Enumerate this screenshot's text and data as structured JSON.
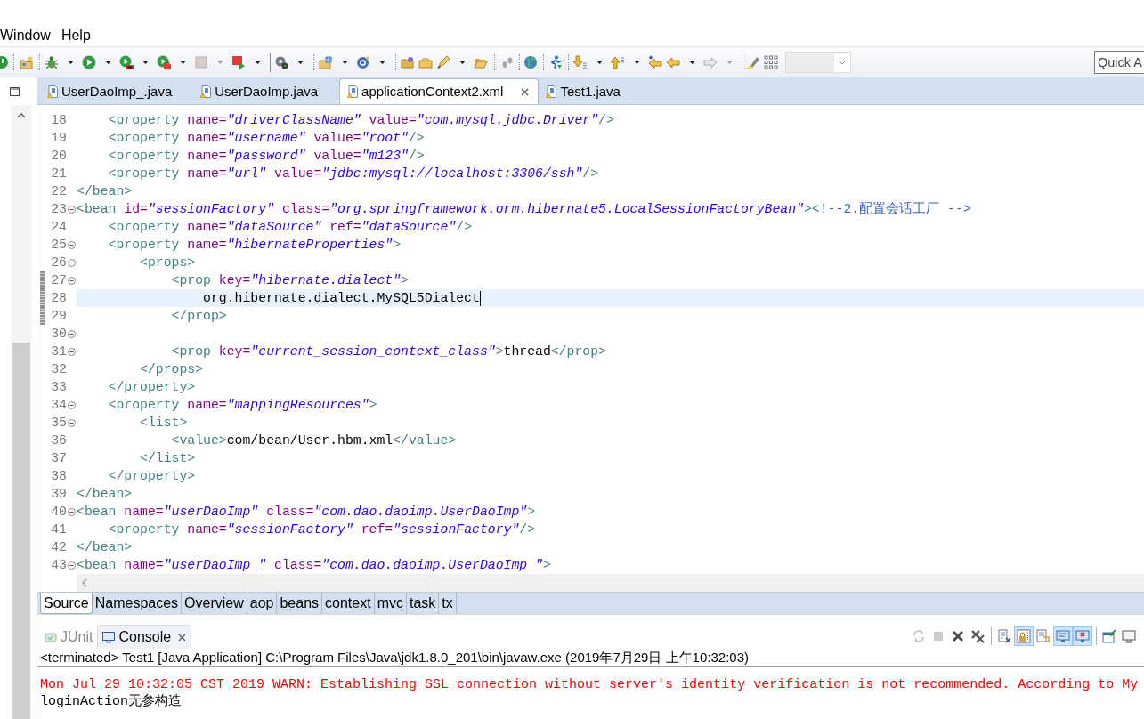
{
  "menu": [
    {
      "label": "Window"
    },
    {
      "label": "Help"
    }
  ],
  "quick_access": {
    "placeholder": "Quick A"
  },
  "editor_tabs": [
    {
      "label": "UserDaoImp_.java",
      "selected": false
    },
    {
      "label": "UserDaoImp.java",
      "selected": false
    },
    {
      "label": "applicationContext2.xml",
      "selected": true
    },
    {
      "label": "Test1.java",
      "selected": false
    }
  ],
  "code_lines": [
    {
      "number": "18",
      "fold": false,
      "marked": false,
      "current": false,
      "tokens": [
        {
          "kind": "tag",
          "text": "    <property"
        },
        {
          "kind": "attr",
          "text": " name="
        },
        {
          "kind": "value",
          "text": "\"driverClassName\""
        },
        {
          "kind": "attr",
          "text": " value="
        },
        {
          "kind": "value",
          "text": "\"com.mysql.jdbc.Driver\""
        },
        {
          "kind": "tag",
          "text": "/>"
        }
      ]
    },
    {
      "number": "19",
      "fold": false,
      "marked": false,
      "current": false,
      "tokens": [
        {
          "kind": "tag",
          "text": "    <property"
        },
        {
          "kind": "attr",
          "text": " name="
        },
        {
          "kind": "value",
          "text": "\"username\""
        },
        {
          "kind": "attr",
          "text": " value="
        },
        {
          "kind": "value",
          "text": "\"root\""
        },
        {
          "kind": "tag",
          "text": "/>"
        }
      ]
    },
    {
      "number": "20",
      "fold": false,
      "marked": false,
      "current": false,
      "tokens": [
        {
          "kind": "tag",
          "text": "    <property"
        },
        {
          "kind": "attr",
          "text": " name="
        },
        {
          "kind": "value",
          "text": "\"password\""
        },
        {
          "kind": "attr",
          "text": " value="
        },
        {
          "kind": "value",
          "text": "\"m123\""
        },
        {
          "kind": "tag",
          "text": "/>"
        }
      ]
    },
    {
      "number": "21",
      "fold": false,
      "marked": false,
      "current": false,
      "tokens": [
        {
          "kind": "tag",
          "text": "    <property"
        },
        {
          "kind": "attr",
          "text": " name="
        },
        {
          "kind": "value",
          "text": "\"url\""
        },
        {
          "kind": "attr",
          "text": " value="
        },
        {
          "kind": "value",
          "text": "\"jdbc:mysql://localhost:3306/ssh\""
        },
        {
          "kind": "tag",
          "text": "/>"
        }
      ]
    },
    {
      "number": "22",
      "fold": false,
      "marked": false,
      "current": false,
      "tokens": [
        {
          "kind": "tag",
          "text": "</bean>"
        }
      ]
    },
    {
      "number": "23",
      "fold": true,
      "marked": false,
      "current": false,
      "tokens": [
        {
          "kind": "tag",
          "text": "<bean"
        },
        {
          "kind": "attr",
          "text": " id="
        },
        {
          "kind": "value",
          "text": "\"sessionFactory\""
        },
        {
          "kind": "attr",
          "text": " class="
        },
        {
          "kind": "value",
          "text": "\"org.springframework.orm.hibernate5.LocalSessionFactoryBean\""
        },
        {
          "kind": "tag",
          "text": ">"
        },
        {
          "kind": "comment",
          "text": "<!--2.配置会话工厂 -->"
        }
      ]
    },
    {
      "number": "24",
      "fold": false,
      "marked": false,
      "current": false,
      "tokens": [
        {
          "kind": "tag",
          "text": "    <property"
        },
        {
          "kind": "attr",
          "text": " name="
        },
        {
          "kind": "value",
          "text": "\"dataSource\""
        },
        {
          "kind": "attr",
          "text": " ref="
        },
        {
          "kind": "value",
          "text": "\"dataSource\""
        },
        {
          "kind": "tag",
          "text": "/>"
        }
      ]
    },
    {
      "number": "25",
      "fold": true,
      "marked": false,
      "current": false,
      "tokens": [
        {
          "kind": "tag",
          "text": "    <property"
        },
        {
          "kind": "attr",
          "text": " name="
        },
        {
          "kind": "value",
          "text": "\"hibernateProperties\""
        },
        {
          "kind": "tag",
          "text": ">"
        }
      ]
    },
    {
      "number": "26",
      "fold": true,
      "marked": false,
      "current": false,
      "tokens": [
        {
          "kind": "tag",
          "text": "        <props>"
        }
      ]
    },
    {
      "number": "27",
      "fold": true,
      "marked": true,
      "current": false,
      "tokens": [
        {
          "kind": "tag",
          "text": "            <prop"
        },
        {
          "kind": "attr",
          "text": " key="
        },
        {
          "kind": "value",
          "text": "\"hibernate.dialect\""
        },
        {
          "kind": "tag",
          "text": ">"
        }
      ]
    },
    {
      "number": "28",
      "fold": false,
      "marked": true,
      "current": true,
      "tokens": [
        {
          "kind": "text",
          "text": "                org.hibernate.dialect.MySQL5Dialect"
        }
      ]
    },
    {
      "number": "29",
      "fold": false,
      "marked": true,
      "current": false,
      "tokens": [
        {
          "kind": "tag",
          "text": "            </prop>"
        }
      ]
    },
    {
      "number": "30",
      "fold": true,
      "marked": false,
      "current": false
    },
    {
      "number": "31",
      "fold": true,
      "marked": false,
      "current": false,
      "tokens": [
        {
          "kind": "tag",
          "text": "            <prop"
        },
        {
          "kind": "attr",
          "text": " key="
        },
        {
          "kind": "value",
          "text": "\"current_session_context_class\""
        },
        {
          "kind": "tag",
          "text": ">"
        },
        {
          "kind": "text",
          "text": "thread"
        },
        {
          "kind": "tag",
          "text": "</prop>"
        }
      ]
    },
    {
      "number": "32",
      "fold": false,
      "marked": false,
      "current": false,
      "tokens": [
        {
          "kind": "tag",
          "text": "        </props>"
        }
      ]
    },
    {
      "number": "33",
      "fold": false,
      "marked": false,
      "current": false,
      "tokens": [
        {
          "kind": "tag",
          "text": "    </property>"
        }
      ]
    },
    {
      "number": "34",
      "fold": true,
      "marked": false,
      "current": false,
      "tokens": [
        {
          "kind": "tag",
          "text": "    <property"
        },
        {
          "kind": "attr",
          "text": " name="
        },
        {
          "kind": "value",
          "text": "\"mappingResources\""
        },
        {
          "kind": "tag",
          "text": ">"
        }
      ]
    },
    {
      "number": "35",
      "fold": true,
      "marked": false,
      "current": false,
      "tokens": [
        {
          "kind": "tag",
          "text": "        <list>"
        }
      ]
    },
    {
      "number": "36",
      "fold": false,
      "marked": false,
      "current": false,
      "tokens": [
        {
          "kind": "tag",
          "text": "            <value>"
        },
        {
          "kind": "text",
          "text": "com/bean/User.hbm.xml"
        },
        {
          "kind": "tag",
          "text": "</value>"
        }
      ]
    },
    {
      "number": "37",
      "fold": false,
      "marked": false,
      "current": false,
      "tokens": [
        {
          "kind": "tag",
          "text": "        </list>"
        }
      ]
    },
    {
      "number": "38",
      "fold": false,
      "marked": false,
      "current": false,
      "tokens": [
        {
          "kind": "tag",
          "text": "    </property>"
        }
      ]
    },
    {
      "number": "39",
      "fold": false,
      "marked": false,
      "current": false,
      "tokens": [
        {
          "kind": "tag",
          "text": "</bean>"
        }
      ]
    },
    {
      "number": "40",
      "fold": true,
      "marked": false,
      "current": false,
      "tokens": [
        {
          "kind": "tag",
          "text": "<bean"
        },
        {
          "kind": "attr",
          "text": " name="
        },
        {
          "kind": "value",
          "text": "\"userDaoImp\""
        },
        {
          "kind": "attr",
          "text": " class="
        },
        {
          "kind": "value",
          "text": "\"com.dao.daoimp.UserDaoImp\""
        },
        {
          "kind": "tag",
          "text": ">"
        }
      ]
    },
    {
      "number": "41",
      "fold": false,
      "marked": false,
      "current": false,
      "tokens": [
        {
          "kind": "tag",
          "text": "    <property"
        },
        {
          "kind": "attr",
          "text": " name="
        },
        {
          "kind": "value",
          "text": "\"sessionFactory\""
        },
        {
          "kind": "attr",
          "text": " ref="
        },
        {
          "kind": "value",
          "text": "\"sessionFactory\""
        },
        {
          "kind": "tag",
          "text": "/>"
        }
      ]
    },
    {
      "number": "42",
      "fold": false,
      "marked": false,
      "current": false,
      "tokens": [
        {
          "kind": "tag",
          "text": "</bean>"
        }
      ]
    },
    {
      "number": "43",
      "fold": true,
      "marked": false,
      "current": false,
      "tokens": [
        {
          "kind": "tag",
          "text": "<bean"
        },
        {
          "kind": "attr",
          "text": " name="
        },
        {
          "kind": "value",
          "text": "\"userDaoImp_\""
        },
        {
          "kind": "attr",
          "text": " class="
        },
        {
          "kind": "value",
          "text": "\"com.dao.daoimp.UserDaoImp_\""
        },
        {
          "kind": "tag",
          "text": ">"
        }
      ]
    }
  ],
  "editor_subtabs": [
    {
      "label": "Source",
      "selected": true
    },
    {
      "label": "Namespaces",
      "selected": false
    },
    {
      "label": "Overview",
      "selected": false
    },
    {
      "label": "aop",
      "selected": false
    },
    {
      "label": "beans",
      "selected": false
    },
    {
      "label": "context",
      "selected": false
    },
    {
      "label": "mvc",
      "selected": false
    },
    {
      "label": "task",
      "selected": false
    },
    {
      "label": "tx",
      "selected": false
    }
  ],
  "console_tabs": [
    {
      "label": "JUnit",
      "selected": false
    },
    {
      "label": "Console",
      "selected": true
    }
  ],
  "console_toolbar": [
    {
      "pressed": false,
      "disabled": true
    },
    {
      "pressed": false,
      "disabled": true
    },
    {
      "pressed": false,
      "disabled": false
    },
    {
      "pressed": false,
      "disabled": false
    },
    {
      "pressed": false,
      "disabled": false
    },
    {
      "pressed": true,
      "disabled": false
    },
    {
      "pressed": false,
      "disabled": false
    },
    {
      "pressed": true,
      "disabled": false
    },
    {
      "pressed": true,
      "disabled": false
    },
    {
      "pressed": false,
      "disabled": false
    },
    {
      "pressed": false,
      "disabled": false
    }
  ],
  "console": {
    "process": "<terminated> Test1 [Java Application] C:\\Program Files\\Java\\jdk1.8.0_201\\bin\\javaw.exe (2019年7月29日 上午10:32:03)",
    "lines": [
      {
        "kind": "stderr",
        "text": "Mon Jul 29 10:32:05 CST 2019 WARN: Establishing SSL connection without server's identity verification is not recommended. According to My"
      },
      {
        "kind": "stdout",
        "text": "loginAction无参构造"
      }
    ]
  }
}
